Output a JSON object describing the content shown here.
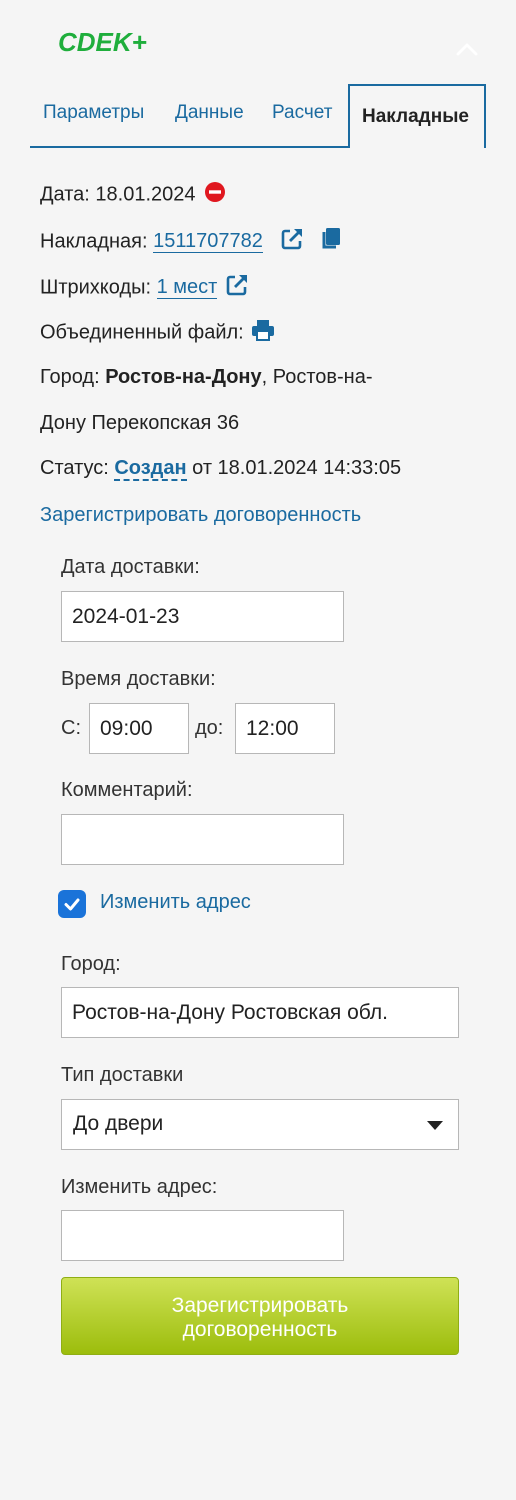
{
  "brand": {
    "logo_text": "CDEK+",
    "accent": "#1a6aa0",
    "brand_green": "#1fae3c"
  },
  "tabs": [
    {
      "label": "Параметры"
    },
    {
      "label": "Данные"
    },
    {
      "label": "Расчет"
    },
    {
      "label": "Накладные",
      "active": true
    }
  ],
  "info": {
    "date_label": "Дата:",
    "date_value": "18.01.2024",
    "invoice_label": "Накладная:",
    "invoice_number": "1511707782",
    "barcodes_label": "Штрихкоды:",
    "barcodes_link": "1 мест",
    "merged_file_label": "Объединенный файл:",
    "city_label": "Город:",
    "city_name": "Ростов-на-Дону",
    "city_address_1": ", Ростов-на-",
    "city_address_2": "Дону Перекопская 36",
    "status_label": "Статус:",
    "status_value": "Создан",
    "status_time": "от 18.01.2024 14:33:05",
    "register_link": "Зарегистрировать договоренность"
  },
  "form": {
    "delivery_date_label": "Дата доставки:",
    "delivery_date_value": "2024-01-23",
    "delivery_time_label": "Время доставки:",
    "from_label": "С:",
    "from_value": "09:00",
    "to_label": "до:",
    "to_value": "12:00",
    "comment_label": "Комментарий:",
    "comment_value": "",
    "change_address_checkbox_label": "Изменить адрес",
    "change_address_checked": true,
    "city_label": "Город:",
    "city_value": "Ростов-на-Дону Ростовская обл.",
    "delivery_type_label": "Тип доставки",
    "delivery_type_value": "До двери",
    "new_address_label": "Изменить адрес:",
    "new_address_value": "",
    "submit_label_line1": "Зарегистрировать",
    "submit_label_line2": "договоренность"
  },
  "icons": {
    "delete": "minus-circle-icon",
    "external": "external-link-icon",
    "copy": "copy-icon",
    "print": "print-icon",
    "collapse": "chevron-up-icon"
  }
}
